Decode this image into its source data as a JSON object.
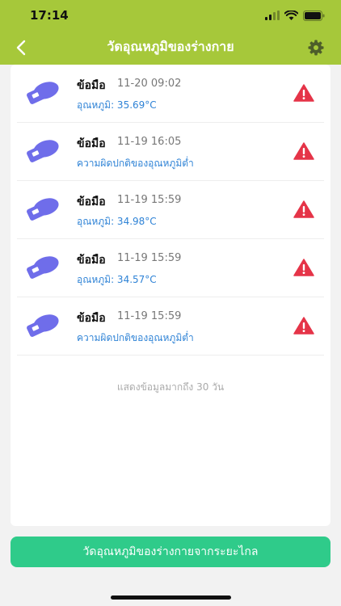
{
  "status_bar": {
    "time": "17:14"
  },
  "header": {
    "title": "วัดอุณหภูมิของร่างกาย"
  },
  "records": [
    {
      "name": "ข้อมือ",
      "time": "11-20 09:02",
      "detail": "อุณหภูมิ: 35.69°C"
    },
    {
      "name": "ข้อมือ",
      "time": "11-19 16:05",
      "detail": "ความผิดปกติของอุณหภูมิต่ำ"
    },
    {
      "name": "ข้อมือ",
      "time": "11-19 15:59",
      "detail": "อุณหภูมิ: 34.98°C"
    },
    {
      "name": "ข้อมือ",
      "time": "11-19 15:59",
      "detail": "อุณหภูมิ: 34.57°C"
    },
    {
      "name": "ข้อมือ",
      "time": "11-19 15:59",
      "detail": "ความผิดปกติของอุณหภูมิต่ำ"
    }
  ],
  "footer_note": "แสดงข้อมูลมากถึง 30 วัน",
  "remote_button_label": "วัดอุณหภูมิของร่างกายจากระยะไกล",
  "colors": {
    "header_bg": "#a6c83a",
    "value_text": "#2f83d6",
    "alert": "#e53448",
    "button": "#2fcb8a",
    "device_icon": "#6f6dea"
  },
  "icons": {
    "back": "chevron-left-icon",
    "settings": "gear-icon",
    "record_device": "wrist-device-icon",
    "record_alert": "warning-triangle-icon"
  }
}
